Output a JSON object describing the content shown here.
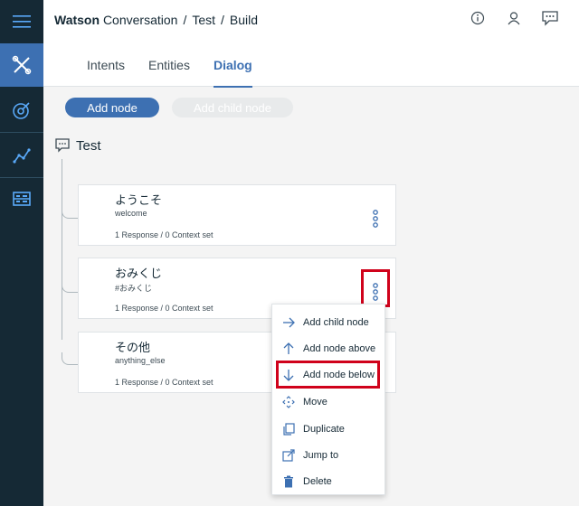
{
  "header": {
    "breadcrumb": {
      "brand": "Watson",
      "product": "Conversation",
      "sep1": "/",
      "workspace": "Test",
      "sep2": "/",
      "page": "Build"
    },
    "tabs": [
      {
        "label": "Intents"
      },
      {
        "label": "Entities"
      },
      {
        "label": "Dialog"
      }
    ]
  },
  "toolbar": {
    "add_node": "Add node",
    "add_child_node": "Add child node"
  },
  "tree": {
    "root_label": "Test",
    "nodes": [
      {
        "title": "ようこそ",
        "condition": "welcome",
        "meta": "1 Response / 0 Context set"
      },
      {
        "title": "おみくじ",
        "condition": "#おみくじ",
        "meta": "1 Response / 0 Context set"
      },
      {
        "title": "その他",
        "condition": "anything_else",
        "meta": "1 Response / 0 Context set"
      }
    ]
  },
  "menu": {
    "items": [
      {
        "label": "Add child node",
        "icon": "arrow-right-icon"
      },
      {
        "label": "Add node above",
        "icon": "arrow-up-icon"
      },
      {
        "label": "Add node below",
        "icon": "arrow-down-icon"
      },
      {
        "label": "Move",
        "icon": "move-icon"
      },
      {
        "label": "Duplicate",
        "icon": "duplicate-icon"
      },
      {
        "label": "Jump to",
        "icon": "jump-to-icon"
      },
      {
        "label": "Delete",
        "icon": "trash-icon"
      }
    ]
  },
  "colors": {
    "accent": "#3d70b2",
    "rail": "#152935",
    "highlight": "#d0021b"
  }
}
